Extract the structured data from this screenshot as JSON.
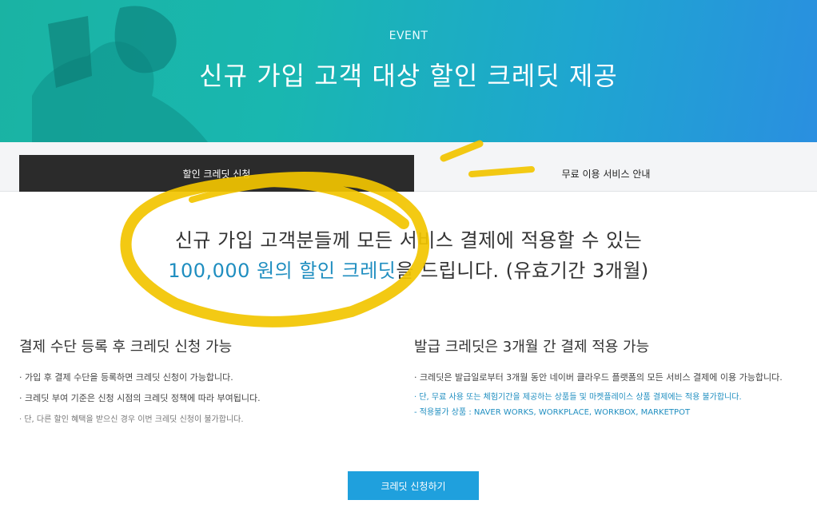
{
  "hero": {
    "eyebrow": "EVENT",
    "title": "신규 가입 고객 대상 할인 크레딧 제공"
  },
  "tabs": [
    {
      "label": "할인 크레딧 신청",
      "active": true
    },
    {
      "label": "무료 이용 서비스 안내",
      "active": false
    }
  ],
  "headline": {
    "line1": "신규 가입 고객분들께 모든 서비스 결제에 적용할 수 있는",
    "line2_accent": "100,000 원의 할인 크레딧",
    "line2_rest": "을 드립니다. (유효기간 3개월)"
  },
  "left": {
    "title": "결제 수단 등록 후 크레딧 신청 가능",
    "bullets": [
      "· 가입 후 결제 수단을 등록하면 크레딧 신청이 가능합니다.",
      "· 크레딧 부여 기준은 신청 시점의 크레딧 정책에 따라 부여됩니다."
    ],
    "note": "· 단, 다른 할인 혜택을 받으신 경우 이번 크레딧 신청이 불가합니다."
  },
  "right": {
    "title": "발급 크레딧은 3개월 간 결제 적용 가능",
    "bullet": "· 크레딧은 발급일로부터 3개월 동안 네이버 클라우드 플랫폼의 모든 서비스 결제에 이용 가능합니다.",
    "note1": "· 단, 무료 사용 또는 체험기간을 제공하는 상품들 및 마켓플레이스 상품 결제에는 적용 불가합니다.",
    "note2": "- 적용불가 상품 : NAVER WORKS, WORKPLACE, WORKBOX, MARKETPOT"
  },
  "cta": {
    "label": "크레딧 신청하기"
  },
  "colors": {
    "accent": "#1f8ec0",
    "button": "#1fa0dd",
    "active_tab": "#2b2b2b",
    "scribble": "#f2c500"
  }
}
